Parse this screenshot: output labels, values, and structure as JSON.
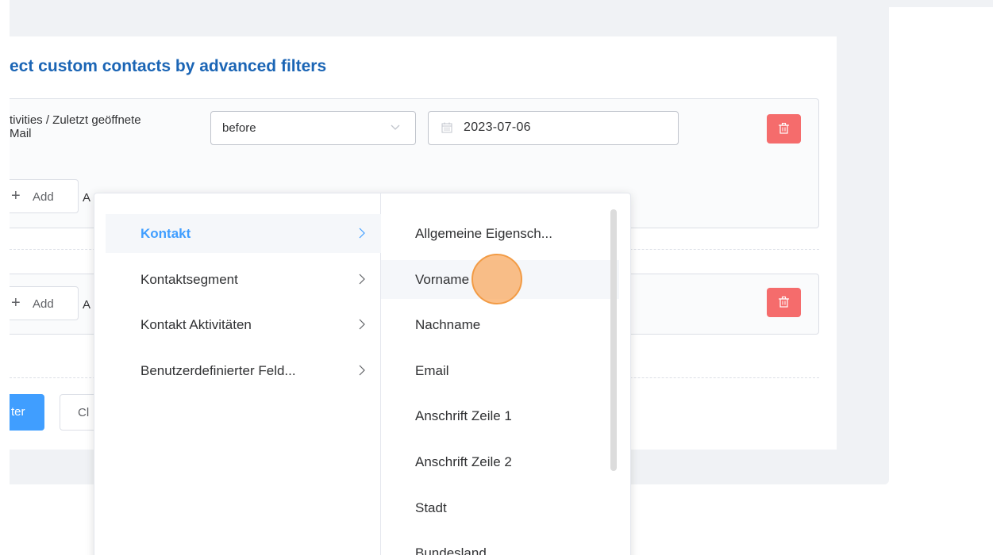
{
  "page": {
    "title": "ect custom contacts by advanced filters"
  },
  "group1": {
    "condition_label": "tivities / Zuletzt geöffnete\nMail",
    "operator_value": "before",
    "date_value": "2023-07-06",
    "add_label": "Add",
    "add_hint": "A"
  },
  "group2": {
    "add_label": "Add",
    "add_hint": "A"
  },
  "actions": {
    "filter_label": "ter",
    "clear_label": "Cl"
  },
  "cascader": {
    "level1": [
      {
        "label": "Kontakt",
        "active": true
      },
      {
        "label": "Kontaktsegment"
      },
      {
        "label": "Kontakt Aktivitäten"
      },
      {
        "label": "Benutzerdefinierter Feld..."
      }
    ],
    "level2": [
      {
        "label": "Allgemeine Eigensch..."
      },
      {
        "label": "Vorname",
        "hover": true
      },
      {
        "label": "Nachname"
      },
      {
        "label": "Email"
      },
      {
        "label": "Anschrift Zeile 1"
      },
      {
        "label": "Anschrift Zeile 2"
      },
      {
        "label": "Stadt"
      },
      {
        "label": "Bundesland"
      }
    ]
  },
  "colors": {
    "title": "#1b65b5",
    "primary": "#409eff",
    "danger": "#f56c6c",
    "cursor": "#f29b45"
  },
  "icons": {
    "delete": "trash-icon",
    "chevron": "chevron-down-icon",
    "calendar": "calendar-icon",
    "arrow": "chevron-right-icon"
  }
}
